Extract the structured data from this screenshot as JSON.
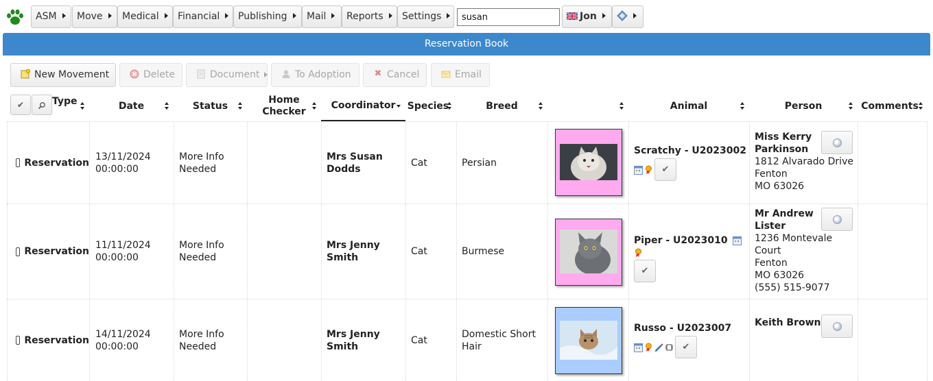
{
  "menu": {
    "items": [
      "ASM",
      "Move",
      "Medical",
      "Financial",
      "Publishing",
      "Mail",
      "Reports",
      "Settings"
    ],
    "search_value": "susan",
    "user": "Jon"
  },
  "page_title": "Reservation Book",
  "toolbar": {
    "new_movement": "New Movement",
    "delete": "Delete",
    "document": "Document",
    "to_adoption": "To Adoption",
    "cancel": "Cancel",
    "email": "Email"
  },
  "columns": {
    "type": "Type",
    "date": "Date",
    "status": "Status",
    "home_checker_1": "Home",
    "home_checker_2": "Checker",
    "coordinator": "Coordinator",
    "species": "Species",
    "breed": "Breed",
    "animal": "Animal",
    "person": "Person",
    "comments": "Comments"
  },
  "rows": [
    {
      "type": "Reservation",
      "date": "13/11/2024",
      "time": "00:00:00",
      "status_1": "More Info",
      "status_2": "Needed",
      "coordinator_1": "Mrs Susan",
      "coordinator_2": "Dodds",
      "species": "Cat",
      "breed_1": "Persian",
      "breed_2": "",
      "animal": "Scratchy - U2023002",
      "photo_bg": "#ffaaee",
      "person_name_1": "Miss Kerry",
      "person_name_2": "Parkinson",
      "address": [
        "1812 Alvarado Drive",
        "Fenton",
        "MO 63026"
      ]
    },
    {
      "type": "Reservation",
      "date": "11/11/2024",
      "time": "00:00:00",
      "status_1": "More Info",
      "status_2": "Needed",
      "coordinator_1": "Mrs Jenny",
      "coordinator_2": "Smith",
      "species": "Cat",
      "breed_1": "Burmese",
      "breed_2": "",
      "animal": "Piper - U2023010",
      "photo_bg": "#ffaaee",
      "person_name_1": "Mr Andrew",
      "person_name_2": "Lister",
      "address": [
        "1236 Montevale",
        "Court",
        "Fenton",
        "MO 63026",
        "(555) 515-9077"
      ]
    },
    {
      "type": "Reservation",
      "date": "14/11/2024",
      "time": "00:00:00",
      "status_1": "More Info",
      "status_2": "Needed",
      "coordinator_1": "Mrs Jenny",
      "coordinator_2": "Smith",
      "species": "Cat",
      "breed_1": "Domestic Short",
      "breed_2": "Hair",
      "animal": "Russo - U2023007",
      "photo_bg": "#aaccff",
      "person_name_1": "Keith Brown",
      "person_name_2": "",
      "address": []
    }
  ]
}
